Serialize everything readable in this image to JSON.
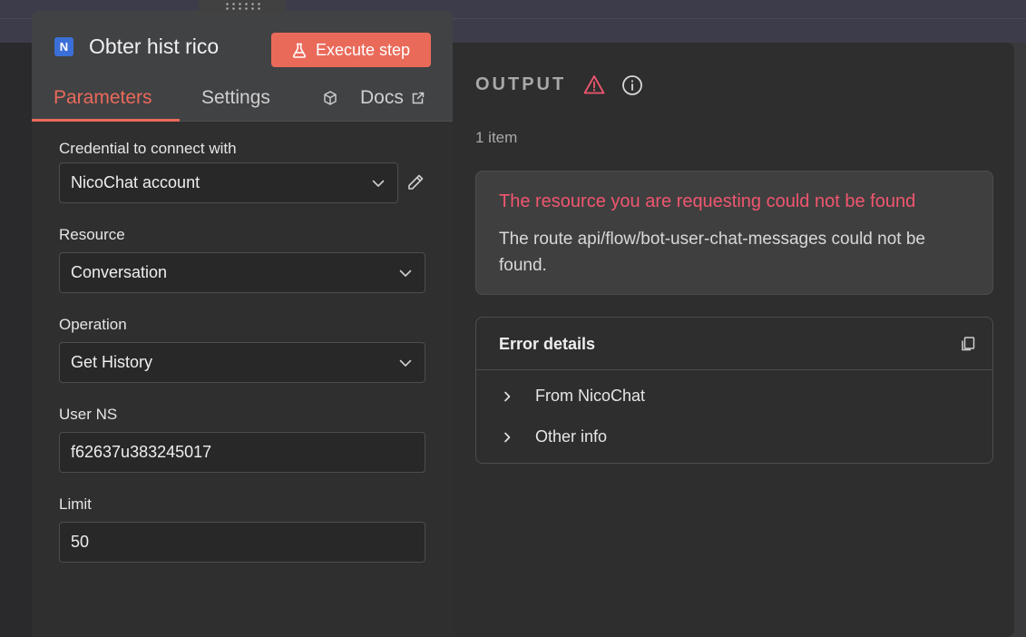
{
  "node": {
    "icon_letter": "N",
    "title": "Obter hist rico",
    "execute_label": "Execute step"
  },
  "tabs": {
    "parameters": "Parameters",
    "settings": "Settings",
    "docs": "Docs"
  },
  "fields": {
    "credential": {
      "label": "Credential to connect with",
      "value": "NicoChat account"
    },
    "resource": {
      "label": "Resource",
      "value": "Conversation"
    },
    "operation": {
      "label": "Operation",
      "value": "Get History"
    },
    "user_ns": {
      "label": "User NS",
      "value": "f62637u383245017"
    },
    "limit": {
      "label": "Limit",
      "value": "50"
    }
  },
  "output": {
    "title": "OUTPUT",
    "item_count": "1 item",
    "error_title": "The resource you are requesting could not be found",
    "error_message": "The route api/flow/bot-user-chat-messages could not be found.",
    "details_title": "Error details",
    "detail_rows": [
      "From NicoChat",
      "Other info"
    ]
  },
  "colors": {
    "accent": "#ea6a5a",
    "error": "#f0566f",
    "node_icon": "#3b6fd8"
  },
  "icons": [
    "flask-icon",
    "cube-icon",
    "external-link-icon",
    "chevron-down-icon",
    "pencil-icon",
    "warning-icon",
    "info-icon",
    "copy-icon",
    "chevron-right-icon"
  ]
}
